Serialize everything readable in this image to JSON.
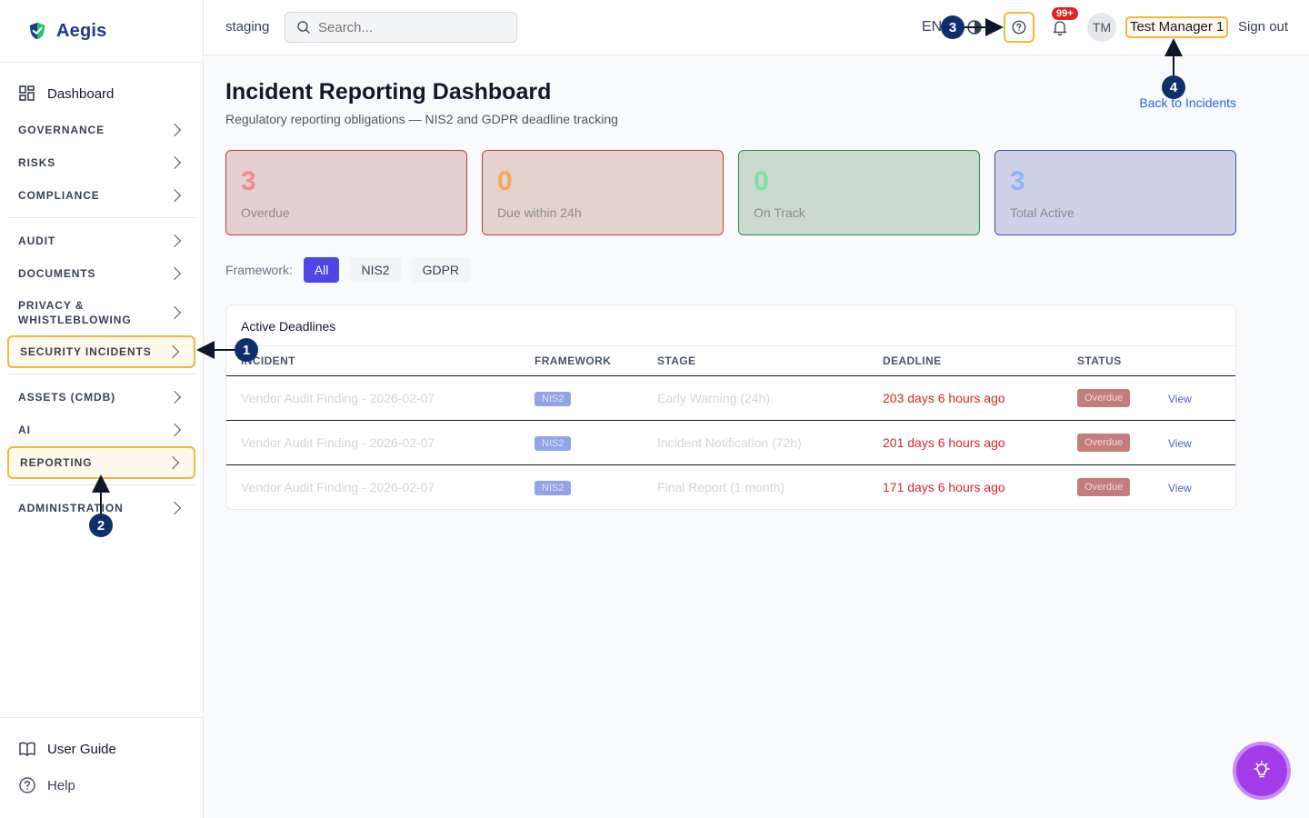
{
  "brand": {
    "name": "Aegis"
  },
  "sidebar": {
    "dashboard": "Dashboard",
    "items": [
      {
        "label": "GOVERNANCE"
      },
      {
        "label": "RISKS"
      },
      {
        "label": "COMPLIANCE"
      },
      {
        "label": "AUDIT"
      },
      {
        "label": "DOCUMENTS"
      },
      {
        "label": "PRIVACY & WHISTLEBLOWING"
      },
      {
        "label": "SECURITY INCIDENTS"
      },
      {
        "label": "ASSETS (CMDB)"
      },
      {
        "label": "AI"
      },
      {
        "label": "REPORTING"
      },
      {
        "label": "ADMINISTRATION"
      }
    ],
    "user_guide": "User Guide",
    "help": "Help"
  },
  "header": {
    "env": "staging",
    "search_placeholder": "Search...",
    "lang": "EN",
    "notifications_badge": "99+",
    "avatar_initials": "TM",
    "username": "Test Manager 1",
    "sign_out": "Sign out"
  },
  "page": {
    "title": "Incident Reporting Dashboard",
    "subtitle": "Regulatory reporting obligations — NIS2 and GDPR deadline tracking",
    "back_link": "Back to Incidents"
  },
  "cards": [
    {
      "value": "3",
      "label": "Overdue"
    },
    {
      "value": "0",
      "label": "Due within 24h"
    },
    {
      "value": "0",
      "label": "On Track"
    },
    {
      "value": "3",
      "label": "Total Active"
    }
  ],
  "filters": {
    "label": "Framework:",
    "options": [
      "All",
      "NIS2",
      "GDPR"
    ],
    "selected": "All"
  },
  "table": {
    "title": "Active Deadlines",
    "columns": [
      "INCIDENT",
      "FRAMEWORK",
      "STAGE",
      "DEADLINE",
      "STATUS"
    ],
    "rows": [
      {
        "incident": "Vendor Audit Finding - 2026-02-07",
        "framework": "NIS2",
        "stage": "Early Warning (24h)",
        "deadline": "203 days 6 hours ago",
        "status": "Overdue",
        "action": "View"
      },
      {
        "incident": "Vendor Audit Finding - 2026-02-07",
        "framework": "NIS2",
        "stage": "Incident Notification (72h)",
        "deadline": "201 days 6 hours ago",
        "status": "Overdue",
        "action": "View"
      },
      {
        "incident": "Vendor Audit Finding - 2026-02-07",
        "framework": "NIS2",
        "stage": "Final Report (1 month)",
        "deadline": "171 days 6 hours ago",
        "status": "Overdue",
        "action": "View"
      }
    ]
  },
  "annotations": [
    "1",
    "2",
    "3",
    "4"
  ],
  "colors": {
    "accent": "#4f46e5",
    "highlight": "#f5b63f",
    "danger": "#dc2626",
    "annotation": "#0f2f6b"
  }
}
